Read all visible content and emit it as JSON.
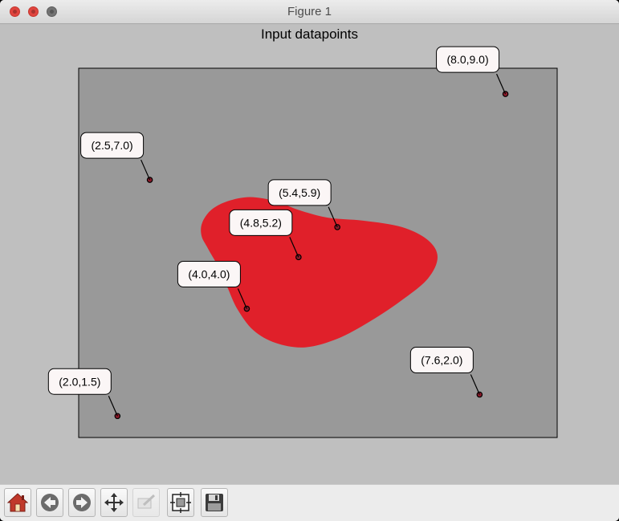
{
  "window": {
    "title": "Figure 1"
  },
  "toolbar": {
    "buttons": [
      {
        "name": "home",
        "icon": "home-icon"
      },
      {
        "name": "back",
        "icon": "arrow-left-icon"
      },
      {
        "name": "forward",
        "icon": "arrow-right-icon"
      },
      {
        "name": "pan",
        "icon": "move-icon"
      },
      {
        "name": "zoom",
        "icon": "zoom-rect-icon"
      },
      {
        "name": "configure-subplots",
        "icon": "subplots-icon"
      },
      {
        "name": "save",
        "icon": "floppy-disk-icon"
      }
    ]
  },
  "colors": {
    "axes_background": "#999999",
    "figure_background": "#bfbfbf",
    "blob_fill": "#e0202a",
    "point_color": "#8b1a2a"
  },
  "chart_data": {
    "type": "scatter",
    "title": "Input datapoints",
    "xlabel": "",
    "ylabel": "",
    "xlim": [
      1.4,
      8.8
    ],
    "ylim": [
      1.0,
      9.6
    ],
    "axis_ticks_visible": false,
    "points": [
      {
        "x": 2.0,
        "y": 1.5,
        "label": "(2.0,1.5)"
      },
      {
        "x": 4.0,
        "y": 4.0,
        "label": "(4.0,4.0)"
      },
      {
        "x": 4.8,
        "y": 5.2,
        "label": "(4.8,5.2)"
      },
      {
        "x": 5.4,
        "y": 5.9,
        "label": "(5.4,5.9)"
      },
      {
        "x": 2.5,
        "y": 7.0,
        "label": "(2.5,7.0)"
      },
      {
        "x": 8.0,
        "y": 9.0,
        "label": "(8.0,9.0)"
      },
      {
        "x": 7.6,
        "y": 2.0,
        "label": "(7.6,2.0)"
      }
    ],
    "shaded_region": {
      "description_color": "red",
      "outline": [
        [
          3.31,
          6.0
        ],
        [
          3.45,
          6.3
        ],
        [
          3.7,
          6.5
        ],
        [
          4.05,
          6.6
        ],
        [
          4.45,
          6.5
        ],
        [
          4.8,
          6.3
        ],
        [
          5.25,
          6.12
        ],
        [
          5.8,
          6.05
        ],
        [
          6.4,
          5.9
        ],
        [
          6.8,
          5.6
        ],
        [
          6.95,
          5.2
        ],
        [
          6.8,
          4.7
        ],
        [
          6.4,
          4.2
        ],
        [
          5.9,
          3.7
        ],
        [
          5.4,
          3.3
        ],
        [
          4.9,
          3.1
        ],
        [
          4.45,
          3.2
        ],
        [
          4.1,
          3.5
        ],
        [
          3.85,
          4.0
        ],
        [
          3.7,
          4.5
        ],
        [
          3.55,
          5.0
        ],
        [
          3.4,
          5.4
        ],
        [
          3.3,
          5.7
        ]
      ]
    }
  }
}
